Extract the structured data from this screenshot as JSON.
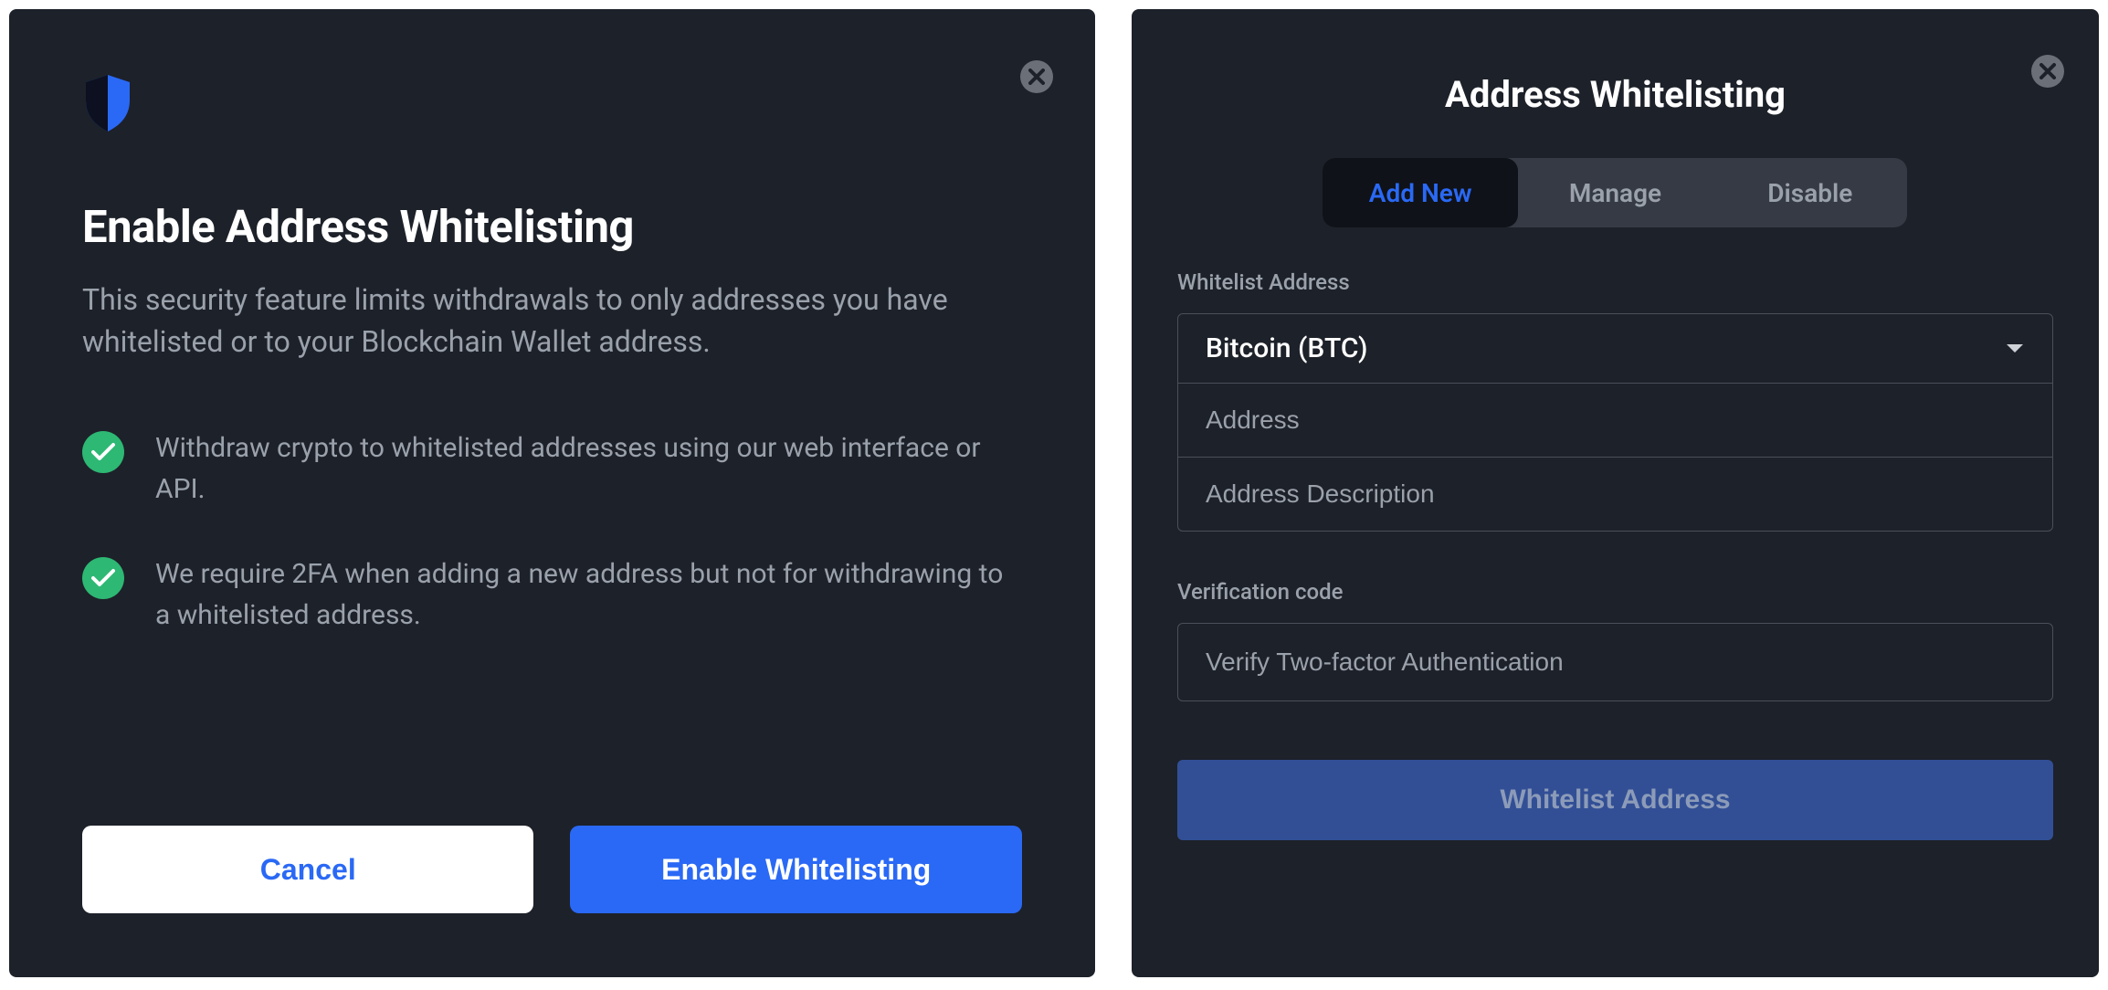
{
  "enable_modal": {
    "title": "Enable Address Whitelisting",
    "description": "This security feature limits withdrawals to only addresses you have whitelisted or to your Blockchain Wallet address.",
    "features": [
      "Withdraw crypto to whitelisted addresses using our web interface or API.",
      "We require 2FA when adding a new address but not for withdrawing to a whitelisted address."
    ],
    "cancel_label": "Cancel",
    "enable_label": "Enable Whitelisting"
  },
  "whitelist_panel": {
    "title": "Address Whitelisting",
    "tabs": [
      "Add New",
      "Manage",
      "Disable"
    ],
    "active_tab_index": 0,
    "section_label": "Whitelist Address",
    "currency_selected": "Bitcoin (BTC)",
    "address_placeholder": "Address",
    "address_desc_placeholder": "Address Description",
    "verification_label": "Verification code",
    "verification_placeholder": "Verify Two-factor Authentication",
    "submit_label": "Whitelist Address"
  }
}
